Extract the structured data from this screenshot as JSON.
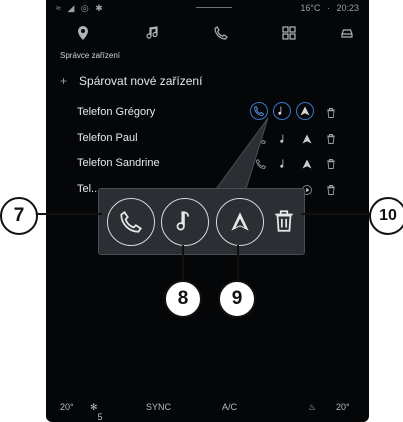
{
  "status": {
    "left": "≈ ◢ ◎ ✱",
    "temp": "16°C",
    "time": "20:23"
  },
  "section_title": "Správce zařízení",
  "pair_new": "Spárovat nové zařízení",
  "devices": [
    {
      "name": "Telefon Grégory"
    },
    {
      "name": "Telefon Paul"
    },
    {
      "name": "Telefon Sandrine"
    },
    {
      "name": "Tel..."
    }
  ],
  "bottom": {
    "temp_left": "20°",
    "fan": "5",
    "sync": "SYNC",
    "ac": "A/C",
    "temp_right": "20°"
  },
  "callouts": {
    "c7": "7",
    "c8": "8",
    "c9": "9",
    "c10": "10"
  },
  "icons": [
    "location-pin-icon",
    "music-note-icon",
    "phone-icon",
    "apps-grid-icon",
    "car-icon",
    "plus-icon",
    "phone-icon",
    "music-note-icon",
    "android-auto-icon",
    "trash-icon"
  ],
  "colors": {
    "accent": "#3a77c8",
    "screen_bg": "#050608",
    "popup_bg": "#2b2e33"
  }
}
